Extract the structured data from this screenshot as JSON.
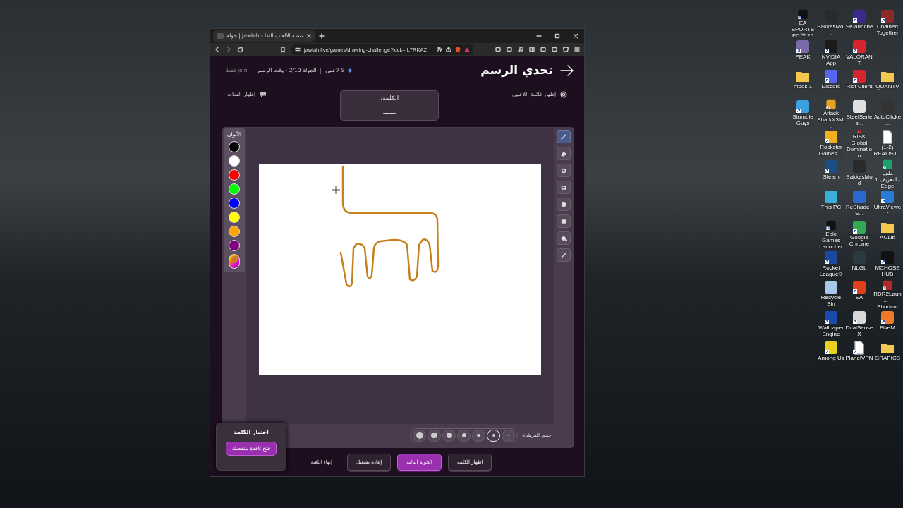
{
  "browser": {
    "tab": {
      "title": "جولة | Jawlah - منصة الألعاب الثقا"
    },
    "url": "jawlah.live/games/drawing-challenge?kick=IL7RKAZ"
  },
  "page": {
    "title": "تحدي الرسم",
    "status": [
      "5 لاعبين",
      "الجولة 2/10 - وقت الرسم",
      "joinl فقط"
    ],
    "show_players": "إظهار قائمة اللاعبين",
    "show_chat": "إظهار الشات",
    "word_card": {
      "label": "الكلمة:",
      "blanks": "_____"
    }
  },
  "palette": {
    "label": "الألوان",
    "colors": [
      {
        "kind": "solid",
        "color": "#000000"
      },
      {
        "kind": "solid",
        "color": "#ffffff"
      },
      {
        "kind": "solid",
        "color": "#ff0000"
      },
      {
        "kind": "solid",
        "color": "#00ff00"
      },
      {
        "kind": "solid",
        "color": "#0000ff"
      },
      {
        "kind": "solid",
        "color": "#ffff00"
      },
      {
        "kind": "solid",
        "color": "#ffa500"
      },
      {
        "kind": "solid",
        "color": "#800080"
      },
      {
        "kind": "custom",
        "color": "#cc7a1e"
      }
    ]
  },
  "tools": [
    {
      "kind": "pen",
      "selected": true
    },
    {
      "kind": "eraser",
      "selected": false
    },
    {
      "kind": "circle",
      "selected": false
    },
    {
      "kind": "rectangle",
      "selected": false
    },
    {
      "kind": "filled-circle",
      "selected": false
    },
    {
      "kind": "filled-rectangle",
      "selected": false
    },
    {
      "kind": "fill",
      "selected": false
    },
    {
      "kind": "line",
      "selected": false
    }
  ],
  "brush": {
    "label": "حجم الفرشاة",
    "sizes": [
      {
        "selected": false
      },
      {
        "selected": true
      },
      {
        "selected": false
      },
      {
        "selected": false
      },
      {
        "selected": false
      },
      {
        "selected": false
      },
      {
        "selected": false
      }
    ]
  },
  "word_picker": {
    "title": "اختيار الكلمة",
    "button": "فتح نافذة منفصلة"
  },
  "actions": [
    {
      "kind": "secondary",
      "label": "اظهار الكلمة"
    },
    {
      "kind": "primary",
      "label": "الجولة التالية"
    },
    {
      "kind": "secondary",
      "label": "إعادة تشغيل"
    },
    {
      "kind": "text",
      "label": "إنهاء اللعبة"
    }
  ],
  "desktop": {
    "rows": [
      [
        {
          "label": "EA SPORTS FC™ 26",
          "kind": "app",
          "color": "#111111",
          "shortcut": true
        },
        {
          "label": "BakkesMo...",
          "kind": "app",
          "color": "#2a2a2a",
          "shortcut": false
        },
        {
          "label": "SKlauncher",
          "kind": "app",
          "color": "#3b2a8a",
          "shortcut": true
        },
        {
          "label": "Chained Together",
          "kind": "app",
          "color": "#8a2a2a",
          "shortcut": true
        }
      ],
      [
        {
          "label": "PEAK",
          "kind": "app",
          "color": "#7a6aa8",
          "shortcut": true
        },
        {
          "label": "NVIDIA App",
          "kind": "app",
          "color": "#1a1a1a",
          "shortcut": true
        },
        {
          "label": "VALORANT",
          "kind": "app",
          "color": "#d4262e",
          "shortcut": true
        },
        null
      ],
      [
        {
          "label": "mods 1",
          "kind": "folder",
          "color": "#f2c94c",
          "shortcut": false
        },
        {
          "label": "Discord",
          "kind": "app",
          "color": "#5865f2",
          "shortcut": true
        },
        {
          "label": "Riot Client",
          "kind": "app",
          "color": "#d4262e",
          "shortcut": true
        },
        {
          "label": "QUANTV",
          "kind": "folder",
          "color": "#f2c94c",
          "shortcut": false
        }
      ],
      [
        {
          "label": "Stumble Guys",
          "kind": "app",
          "color": "#3aa0e0",
          "shortcut": true
        },
        {
          "label": "Attack SharkX3M...",
          "kind": "app",
          "color": "#e8a020",
          "shortcut": true
        },
        {
          "label": "SteelSeries...",
          "kind": "app",
          "color": "#e0e0e0",
          "shortcut": false
        },
        {
          "label": "AutoClicke...",
          "kind": "app",
          "color": "#333333",
          "shortcut": false
        }
      ],
      [
        null,
        {
          "label": "Rockstar Games ...",
          "kind": "app",
          "color": "#f2b01e",
          "shortcut": true
        },
        {
          "label": "RISK Global Domination",
          "kind": "app",
          "color": "#c8202a",
          "shortcut": true
        },
        {
          "label": "(1-2) REALIST...",
          "kind": "file",
          "color": "#ffffff",
          "shortcut": false
        }
      ],
      [
        null,
        {
          "label": "Steam",
          "kind": "app",
          "color": "#1b4e80",
          "shortcut": true
        },
        {
          "label": "BakkesMod",
          "kind": "app",
          "color": "#2a2a2a",
          "shortcut": false
        },
        {
          "label": "ملف التعريف 1 - Edge",
          "kind": "app",
          "color": "#1ea06a",
          "shortcut": true
        }
      ],
      [
        null,
        {
          "label": "This PC",
          "kind": "app",
          "color": "#3ab0d8",
          "shortcut": false
        },
        {
          "label": "ReShade_S...",
          "kind": "app",
          "color": "#2a6ad0",
          "shortcut": false
        },
        {
          "label": "UltraViewer",
          "kind": "app",
          "color": "#2a7ad8",
          "shortcut": true
        }
      ],
      [
        null,
        {
          "label": "Epic Games Launcher",
          "kind": "app",
          "color": "#111111",
          "shortcut": true
        },
        {
          "label": "Google Chrome",
          "kind": "app",
          "color": "#34a853",
          "shortcut": true
        },
        {
          "label": "ACLib",
          "kind": "folder",
          "color": "#f2c94c",
          "shortcut": false
        }
      ],
      [
        null,
        {
          "label": "Rocket League®",
          "kind": "app",
          "color": "#1a4aa0",
          "shortcut": true
        },
        {
          "label": "NLGL",
          "kind": "app",
          "color": "#2a3a40",
          "shortcut": false
        },
        {
          "label": "MCHOSE HUB",
          "kind": "app",
          "color": "#111111",
          "shortcut": true
        }
      ],
      [
        null,
        {
          "label": "Recycle Bin",
          "kind": "app",
          "color": "#a8c8e8",
          "shortcut": false
        },
        {
          "label": "EA",
          "kind": "app",
          "color": "#e0401a",
          "shortcut": true
        },
        {
          "label": "RDR2Laun... - Shortcut",
          "kind": "app",
          "color": "#b02a2a",
          "shortcut": true
        }
      ],
      [
        null,
        {
          "label": "Wallpaper Engine",
          "kind": "app",
          "color": "#1a4ab0",
          "shortcut": true
        },
        {
          "label": "DualSenseX",
          "kind": "app",
          "color": "#d8d8d8",
          "shortcut": true
        },
        {
          "label": "FiveM",
          "kind": "app",
          "color": "#f07a2a",
          "shortcut": true
        }
      ],
      [
        null,
        {
          "label": "Among Us",
          "kind": "app",
          "color": "#e8d020",
          "shortcut": true
        },
        {
          "label": "PlanetVPN",
          "kind": "file",
          "color": "#ffffff",
          "shortcut": true
        },
        {
          "label": "GRAPICS",
          "kind": "folder",
          "color": "#f2c94c",
          "shortcut": false
        }
      ]
    ]
  }
}
